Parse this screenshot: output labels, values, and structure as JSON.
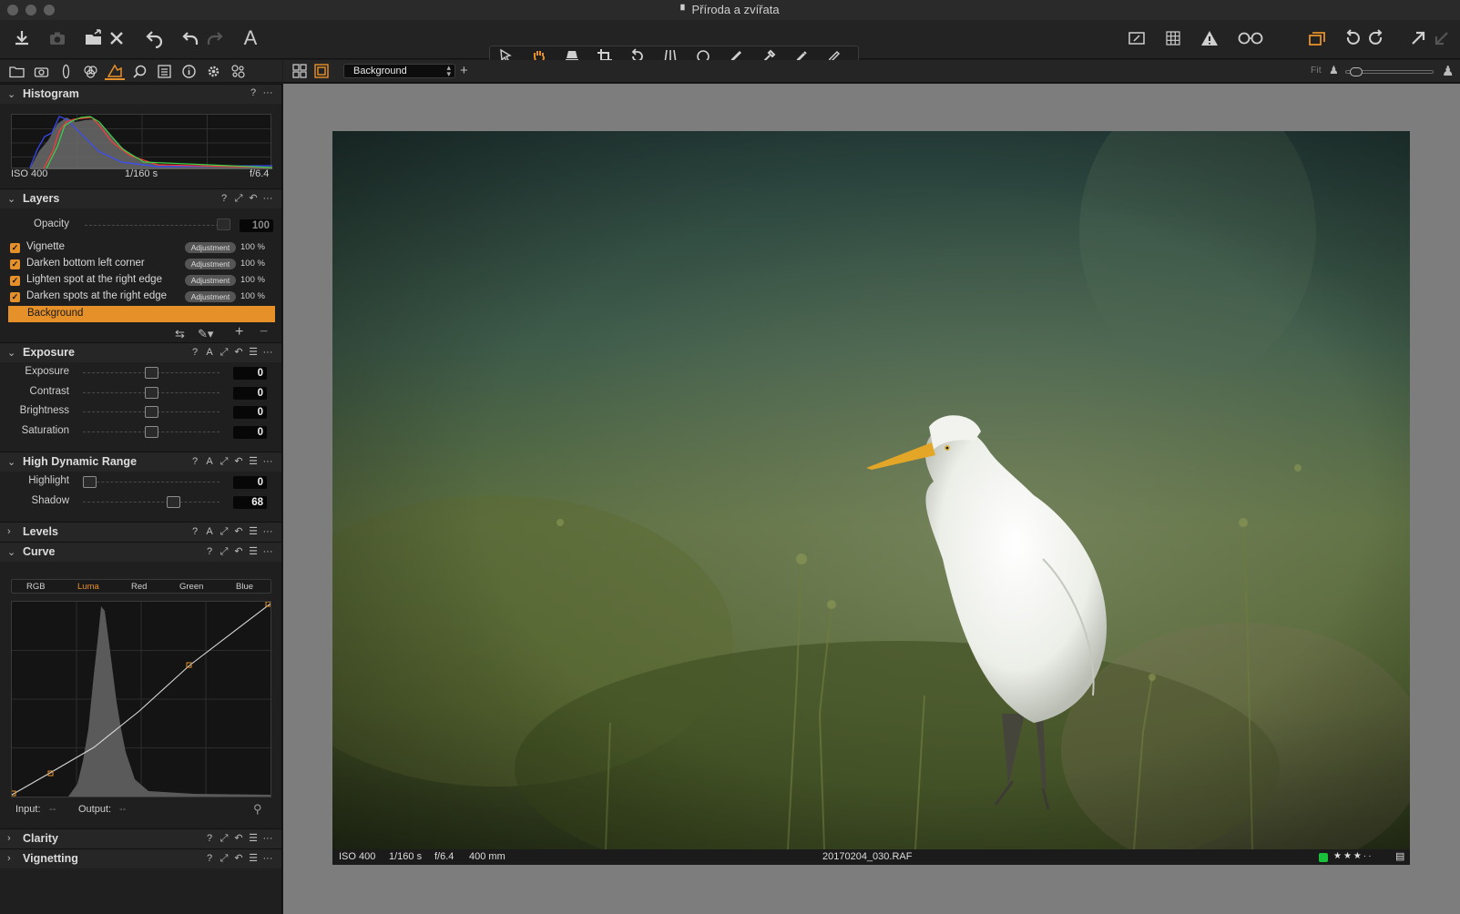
{
  "window": {
    "title": "Příroda a zvířata"
  },
  "viewer_toolbar": {
    "variant_select": "Background",
    "zoom_label": "Fit"
  },
  "histogram": {
    "title": "Histogram",
    "iso": "ISO 400",
    "shutter": "1/160 s",
    "aperture": "f/6.4"
  },
  "layers": {
    "title": "Layers",
    "opacity_label": "Opacity",
    "opacity_value": "100",
    "items": [
      {
        "name": "Vignette",
        "type": "Adjustment",
        "opacity": "100 %"
      },
      {
        "name": "Darken bottom left corner",
        "type": "Adjustment",
        "opacity": "100 %"
      },
      {
        "name": "Lighten spot at the right edge",
        "type": "Adjustment",
        "opacity": "100 %"
      },
      {
        "name": "Darken spots at the right edge",
        "type": "Adjustment",
        "opacity": "100 %"
      }
    ],
    "selected": "Background"
  },
  "exposure": {
    "title": "Exposure",
    "sliders": [
      {
        "label": "Exposure",
        "value": "0",
        "level": 0.5
      },
      {
        "label": "Contrast",
        "value": "0",
        "level": 0.5
      },
      {
        "label": "Brightness",
        "value": "0",
        "level": 0.5
      },
      {
        "label": "Saturation",
        "value": "0",
        "level": 0.5
      }
    ]
  },
  "hdr": {
    "title": "High Dynamic Range",
    "sliders": [
      {
        "label": "Highlight",
        "value": "0",
        "level": 0.0
      },
      {
        "label": "Shadow",
        "value": "68",
        "level": 0.68
      }
    ]
  },
  "levels": {
    "title": "Levels"
  },
  "curve": {
    "title": "Curve",
    "tabs": [
      "RGB",
      "Luma",
      "Red",
      "Green",
      "Blue"
    ],
    "active_tab": "Luma",
    "input_label": "Input:",
    "input_value": "--",
    "output_label": "Output:",
    "output_value": "--"
  },
  "clarity": {
    "title": "Clarity"
  },
  "vignetting": {
    "title": "Vignetting"
  },
  "photo_info": {
    "iso": "ISO 400",
    "shutter": "1/160 s",
    "aperture": "f/6.4",
    "focal": "400 mm",
    "filename": "20170204_030.RAF",
    "rating": "★★★··",
    "color_tag": "#19c23a"
  },
  "colors": {
    "accent": "#e6902a",
    "panel": "#1f1f1f",
    "viewer_bg": "#7d7d7d"
  }
}
